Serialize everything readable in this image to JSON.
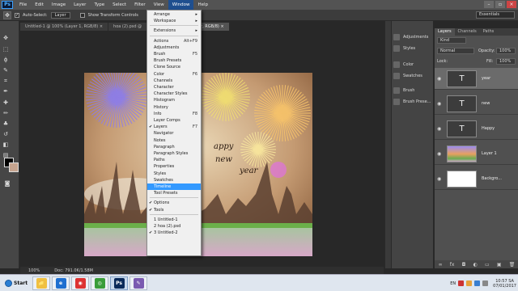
{
  "menubar": {
    "app_logo": "Ps",
    "items": [
      "File",
      "Edit",
      "Image",
      "Layer",
      "Type",
      "Select",
      "Filter",
      "View",
      "Window",
      "Help"
    ],
    "active_index": 8
  },
  "options": {
    "auto_select_label": "Auto-Select:",
    "auto_select_value": "Layer",
    "transform_label": "Show Transform Controls",
    "workspace": "Essentials"
  },
  "doc_tabs": [
    "Untitled-1 @ 100% (Layer 1, RGB/8) ×",
    "hoa (2).psd @",
    "Untitled-2 @ 100% (year, RGB/8) ×"
  ],
  "artwork_text": {
    "happy": "appy",
    "new": "new",
    "year": "year"
  },
  "status": {
    "zoom": "100%",
    "doc": "Doc: 791.0K/1.58M"
  },
  "window_menu": {
    "sections": [
      [
        {
          "label": "Arrange",
          "arrow": "▸"
        },
        {
          "label": "Workspace",
          "arrow": "▸"
        }
      ],
      [
        {
          "label": "Extensions",
          "arrow": "▸"
        }
      ],
      [
        {
          "label": "Actions",
          "shortcut": "Alt+F9"
        },
        {
          "label": "Adjustments"
        },
        {
          "label": "Brush",
          "shortcut": "F5"
        },
        {
          "label": "Brush Presets"
        },
        {
          "label": "Clone Source"
        },
        {
          "label": "Color",
          "shortcut": "F6"
        },
        {
          "label": "Channels"
        },
        {
          "label": "Character"
        },
        {
          "label": "Character Styles"
        },
        {
          "label": "Histogram"
        },
        {
          "label": "History"
        },
        {
          "label": "Info",
          "shortcut": "F8"
        },
        {
          "label": "Layer Comps"
        },
        {
          "label": "Layers",
          "shortcut": "F7",
          "checked": true
        },
        {
          "label": "Navigator"
        },
        {
          "label": "Notes"
        },
        {
          "label": "Paragraph"
        },
        {
          "label": "Paragraph Styles"
        },
        {
          "label": "Paths"
        },
        {
          "label": "Properties"
        },
        {
          "label": "Styles"
        },
        {
          "label": "Swatches"
        },
        {
          "label": "Timeline",
          "highlighted": true
        },
        {
          "label": "Tool Presets"
        }
      ],
      [
        {
          "label": "Options",
          "checked": true
        },
        {
          "label": "Tools",
          "checked": true
        }
      ],
      [
        {
          "label": "1 Untitled-1"
        },
        {
          "label": "2 hoa (2).psd"
        },
        {
          "label": "3 Untitled-2",
          "checked": true
        }
      ]
    ]
  },
  "side_panels": [
    {
      "label": "Adjustments"
    },
    {
      "label": "Styles"
    },
    {
      "label": "Color"
    },
    {
      "label": "Swatches"
    },
    {
      "label": "Brush"
    },
    {
      "label": "Brush Prese..."
    }
  ],
  "layers_panel": {
    "tabs": [
      "Layers",
      "Channels",
      "Paths"
    ],
    "kind": "Kind",
    "blend_mode": "Normal",
    "opacity_label": "Opacity:",
    "opacity_value": "100%",
    "lock_label": "Lock:",
    "fill_label": "Fill:",
    "fill_value": "100%",
    "layers": [
      {
        "name": "year",
        "kind": "text",
        "selected": true
      },
      {
        "name": "new",
        "kind": "text"
      },
      {
        "name": "Happy",
        "kind": "text"
      },
      {
        "name": "Layer 1",
        "kind": "image"
      },
      {
        "name": "Backgro...",
        "kind": "white"
      }
    ],
    "footer_icons": [
      "∞",
      "fx",
      "◘",
      "◐",
      "▭",
      "▣",
      "🗑"
    ]
  },
  "taskbar": {
    "start": "Start",
    "apps": [
      {
        "glyph": "📁",
        "color": "#f0c040"
      },
      {
        "glyph": "e",
        "color": "#1f6fd0"
      },
      {
        "glyph": "◉",
        "color": "#d33"
      },
      {
        "glyph": "◎",
        "color": "#3a9d3a"
      },
      {
        "glyph": "Ps",
        "color": "#0a2a5a"
      },
      {
        "glyph": "✎",
        "color": "#7a5ab0"
      }
    ],
    "lang": "EN",
    "time": "10:57 SA",
    "date": "07/01/2017"
  },
  "colors": {
    "accent": "#3399ff",
    "menu_active": "#1f4f8f"
  }
}
